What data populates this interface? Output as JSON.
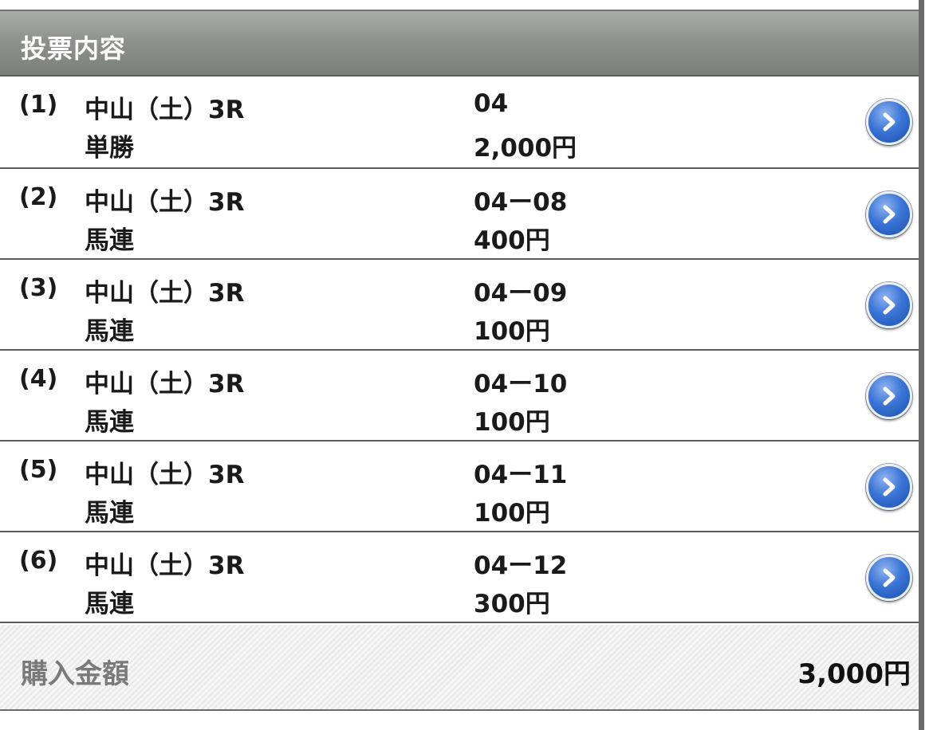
{
  "header": {
    "title": "投票内容"
  },
  "bets": [
    {
      "index": "(1)",
      "race": "中山（土）3R",
      "bet_type": "単勝",
      "combination": "04",
      "amount": "2,000円",
      "icon": "chevron-right-icon"
    },
    {
      "index": "(2)",
      "race": "中山（土）3R",
      "bet_type": "馬連",
      "combination": "04ー08",
      "amount": "400円",
      "icon": "chevron-right-icon"
    },
    {
      "index": "(3)",
      "race": "中山（土）3R",
      "bet_type": "馬連",
      "combination": "04ー09",
      "amount": "100円",
      "icon": "chevron-right-icon"
    },
    {
      "index": "(4)",
      "race": "中山（土）3R",
      "bet_type": "馬連",
      "combination": "04ー10",
      "amount": "100円",
      "icon": "chevron-right-icon"
    },
    {
      "index": "(5)",
      "race": "中山（土）3R",
      "bet_type": "馬連",
      "combination": "04ー11",
      "amount": "100円",
      "icon": "chevron-right-icon"
    },
    {
      "index": "(6)",
      "race": "中山（土）3R",
      "bet_type": "馬連",
      "combination": "04ー12",
      "amount": "300円",
      "icon": "chevron-right-icon"
    }
  ],
  "total": {
    "label": "購入金額",
    "value": "3,000円"
  },
  "colors": {
    "header_bg": "#8e938d",
    "header_text": "#ffffff",
    "row_text": "#1a1a1a",
    "button_blue": "#3b75d6",
    "divider": "#5a5a5a",
    "total_label": "#7a7a7a"
  }
}
